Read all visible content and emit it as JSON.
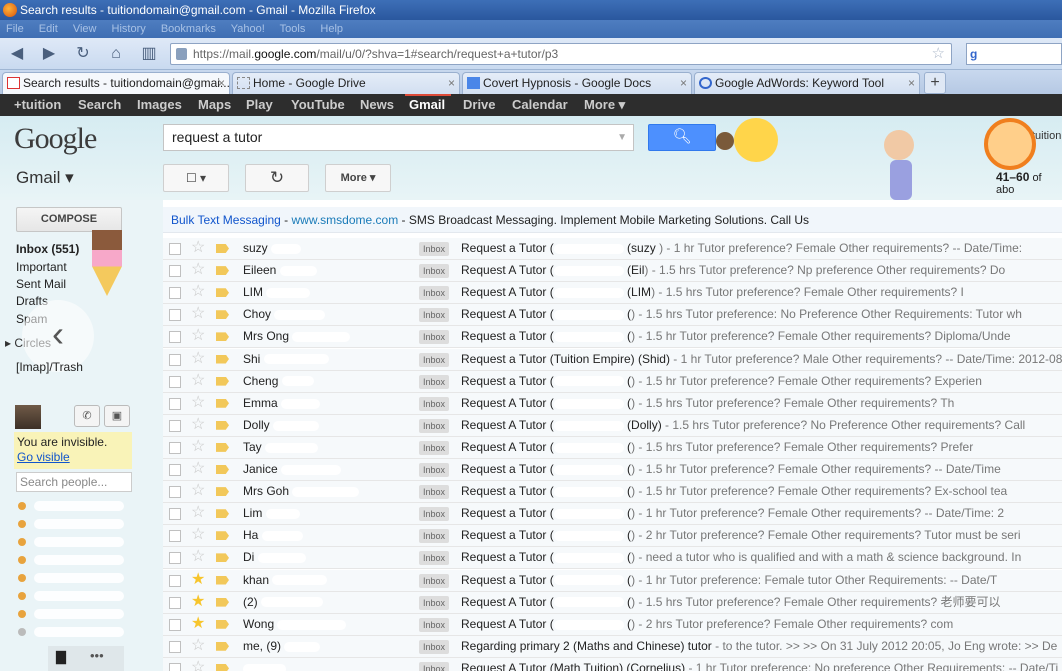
{
  "window": {
    "title": "Search results - tuitiondomain@gmail.com - Gmail - Mozilla Firefox"
  },
  "menu": [
    "File",
    "Edit",
    "View",
    "History",
    "Bookmarks",
    "Yahoo!",
    "Tools",
    "Help"
  ],
  "nav": {
    "url_prefix": "https://mail.",
    "url_domain": "google.com",
    "url_rest": "/mail/u/0/?shva=1#search/request+a+tutor/p3"
  },
  "tabs": [
    {
      "label": "Search results - tuitiondomain@gmai...",
      "icon": "gmail-icon",
      "close": "×"
    },
    {
      "label": "Home - Google Drive",
      "icon": "drive-icon",
      "close": "×"
    },
    {
      "label": "Covert Hypnosis - Google Docs",
      "icon": "docs-icon",
      "close": "×"
    },
    {
      "label": "Google AdWords: Keyword Tool",
      "icon": "google-icon",
      "close": "×"
    }
  ],
  "new_tab": "+",
  "gbar": [
    "+tuition",
    "Search",
    "Images",
    "Maps",
    "Play",
    "YouTube",
    "News",
    "Gmail",
    "Drive",
    "Calendar",
    "More ▾"
  ],
  "gbar_selected": "Gmail",
  "header": {
    "logo": "Google",
    "search_value": "request a tutor",
    "app_menu": "Gmail ▾",
    "more_label": "More ▾",
    "count_text": "41–60",
    "count_suffix": "of abo",
    "corner_text": "tuition"
  },
  "ad": {
    "title": "Bulk Text Messaging",
    "url": "www.smsdome.com",
    "text": " - SMS Broadcast Messaging. Implement Mobile Marketing Solutions. Call Us"
  },
  "sidebar": {
    "compose": "COMPOSE",
    "labels": [
      "Inbox (551)",
      "Important",
      "Sent Mail",
      "Drafts",
      "Spam"
    ],
    "circles": "▸ Circles",
    "imap_trash": "[Imap]/Trash",
    "invisible_text": "You are invisible.",
    "go_visible": "Go visible",
    "search_people_placeholder": "Search people..."
  },
  "emails": [
    {
      "from": "suzy",
      "starred": false,
      "important": true,
      "badge": "Inbox",
      "subject": "Request a Tutor (",
      "subject_tail": " (suzy ",
      "snippet": ") - 1 hr Tutor preference? Female Other requirements? -- Date/Time:"
    },
    {
      "from": "Eileen",
      "starred": false,
      "important": true,
      "badge": "Inbox",
      "subject": "Request A Tutor (",
      "subject_tail": " (Eil",
      "snippet": ") - 1.5 hrs Tutor preference? Np preference Other requirements? Do"
    },
    {
      "from": "LIM",
      "starred": false,
      "important": true,
      "badge": "Inbox",
      "subject": "Request A Tutor (",
      "subject_tail": " (LIM",
      "snippet": ") - 1.5 hrs Tutor preference? Female Other requirements? I"
    },
    {
      "from": "Choy",
      "starred": false,
      "important": true,
      "badge": "Inbox",
      "subject": "Request A Tutor (",
      "subject_tail": " (",
      "snippet": ") - 1.5 hrs Tutor preference: No Preference Other Requirements: Tutor wh"
    },
    {
      "from": "Mrs Ong",
      "starred": false,
      "important": true,
      "badge": "Inbox",
      "subject": "Request a Tutor (",
      "subject_tail": " (",
      "snippet": ") - 1.5 hr Tutor preference? Female Other requirements? Diploma/Unde"
    },
    {
      "from": "Shi",
      "starred": false,
      "important": true,
      "badge": "Inbox",
      "subject": "Request a Tutor (Tuition Empire) (Shid)",
      "subject_tail": "",
      "snippet": " - 1 hr Tutor preference? Male Other requirements? -- Date/Time: 2012-08-"
    },
    {
      "from": "Cheng",
      "starred": false,
      "important": true,
      "badge": "Inbox",
      "subject": "Request a Tutor (",
      "subject_tail": " (",
      "snippet": ") - 1.5 hr Tutor preference? Female Other requirements? Experien"
    },
    {
      "from": "Emma",
      "starred": false,
      "important": true,
      "badge": "Inbox",
      "subject": "Request A Tutor (",
      "subject_tail": " (",
      "snippet": ") - 1.5 hrs Tutor preference? Female Other requirements? Th"
    },
    {
      "from": "Dolly",
      "starred": false,
      "important": true,
      "badge": "Inbox",
      "subject": "Request A Tutor (",
      "subject_tail": " (Dolly)",
      "snippet": " - 1.5 hrs Tutor preference? No Preference Other requirements? Call"
    },
    {
      "from": "Tay",
      "starred": false,
      "important": true,
      "badge": "Inbox",
      "subject": "Request A Tutor (",
      "subject_tail": " (",
      "snippet": ") - 1.5 hrs Tutor preference? Female Other requirements? Prefer"
    },
    {
      "from": "Janice",
      "starred": false,
      "important": true,
      "badge": "Inbox",
      "subject": "Request a Tutor (",
      "subject_tail": " (",
      "snippet": ") - 1.5 hr Tutor preference? Female Other requirements? -- Date/Time"
    },
    {
      "from": "Mrs Goh",
      "starred": false,
      "important": true,
      "badge": "Inbox",
      "subject": "Request a Tutor (",
      "subject_tail": " (",
      "snippet": ") - 1.5 hr Tutor preference? Female Other requirements? Ex-school tea"
    },
    {
      "from": "Lim",
      "starred": false,
      "important": true,
      "badge": "Inbox",
      "subject": "Request a Tutor (",
      "subject_tail": " (",
      "snippet": ") - 1 hr Tutor preference? Female Other requirements? -- Date/Time: 2"
    },
    {
      "from": "Ha",
      "starred": false,
      "important": true,
      "badge": "Inbox",
      "subject": "Request a Tutor (",
      "subject_tail": " (",
      "snippet": ") - 2 hr Tutor preference? Female Other requirements? Tutor must be seri"
    },
    {
      "from": "Di",
      "starred": false,
      "important": true,
      "badge": "Inbox",
      "subject": "Request a Tutor (",
      "subject_tail": " (",
      "snippet": ") - need a tutor who is qualified and with a math & science background. In"
    },
    {
      "from": "khan",
      "starred": true,
      "important": true,
      "badge": "Inbox",
      "subject": "Request a Tutor (",
      "subject_tail": " (",
      "snippet": ") - 1 hr Tutor preference: Female tutor Other Requirements: -- Date/T"
    },
    {
      "from": "(2)",
      "starred": true,
      "important": true,
      "badge": "Inbox",
      "subject": "Request A Tutor (",
      "subject_tail": " (",
      "snippet": ") - 1.5 hrs Tutor preference? Female Other requirements? 老师要可以"
    },
    {
      "from": "Wong",
      "starred": true,
      "important": true,
      "badge": "Inbox",
      "subject": "Request A Tutor (",
      "subject_tail": " (",
      "snippet": ") - 2 hrs Tutor preference? Female Other requirements? com"
    },
    {
      "from": "me, (9)",
      "starred": false,
      "important": true,
      "badge": "Inbox",
      "subject": "Regarding primary 2 (Maths and Chinese) tutor",
      "subject_tail": "",
      "snippet": " - to the tutor. >> >> On 31 July 2012 20:05, Jo Eng wrote: >> De"
    },
    {
      "from": "",
      "starred": false,
      "important": true,
      "badge": "Inbox",
      "subject": "Request A Tutor (Math Tuition) (Cornelius)",
      "subject_tail": "",
      "snippet": " - 1 hr Tutor preference: No preference Other Requirements: -- Date/Ti"
    }
  ],
  "colors": {
    "compose_blue": "#4d90fe",
    "gbar_bg": "#2d2d2d",
    "selected_red": "#dd4b39",
    "star": "#f7c52c",
    "important": "#f2c85a"
  }
}
